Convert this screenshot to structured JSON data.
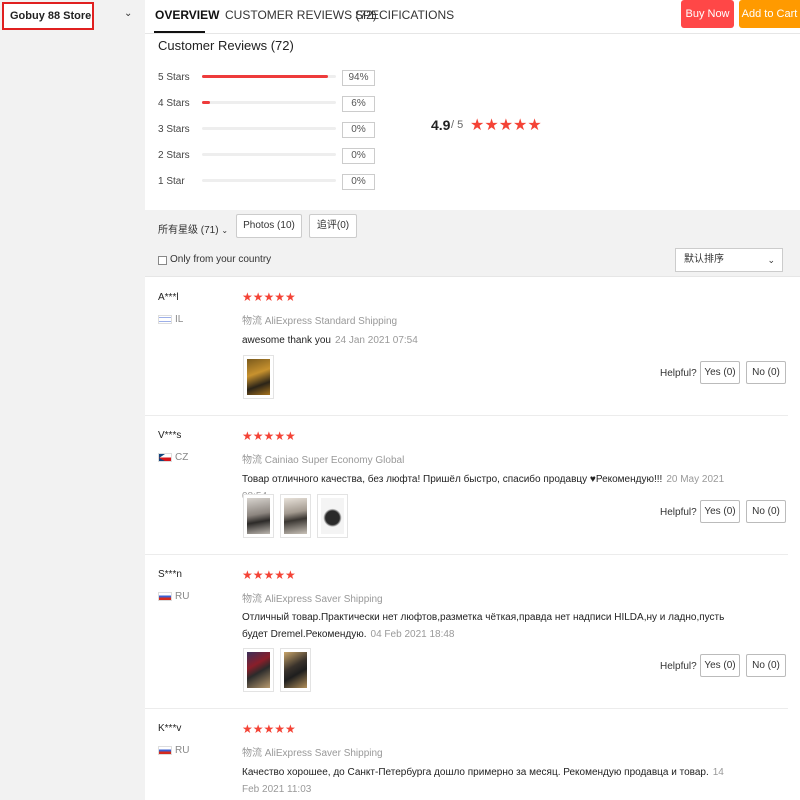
{
  "store": {
    "name": "Gobuy 88 Store",
    "chevron": "⌄"
  },
  "tabs": [
    {
      "label": "OVERVIEW"
    },
    {
      "label": "CUSTOMER REVIEWS (72)"
    },
    {
      "label": "SPECIFICATIONS"
    }
  ],
  "actions": {
    "buy_now": "Buy Now",
    "add_to_cart": "Add to Cart"
  },
  "summary": {
    "title": "Customer Reviews (72)",
    "score": "4.9",
    "out_of": "/ 5",
    "stars": "★★★★★",
    "distribution": [
      {
        "label": "5 Stars",
        "percent_text": "94%",
        "fraction": 0.94
      },
      {
        "label": "4 Stars",
        "percent_text": "6%",
        "fraction": 0.06
      },
      {
        "label": "3 Stars",
        "percent_text": "0%",
        "fraction": 0
      },
      {
        "label": "2 Stars",
        "percent_text": "0%",
        "fraction": 0
      },
      {
        "label": "1 Star",
        "percent_text": "0%",
        "fraction": 0
      }
    ]
  },
  "filters": {
    "all_ratings": "所有星级 (71)",
    "photos": "Photos (10)",
    "additional": "追评(0)",
    "only_country": "Only from your country",
    "sort": "默认排序"
  },
  "reviews": [
    {
      "name": "A***l",
      "country": "IL",
      "stars": "★★★★★",
      "shipping": "物流 AliExpress Standard Shipping",
      "comment": "awesome thank you",
      "date": "24 Jan 2021 07:54",
      "helpful": "Helpful?",
      "yes": "Yes (0)",
      "no": "No (0)"
    },
    {
      "name": "V***s",
      "country": "CZ",
      "stars": "★★★★★",
      "shipping": "物流 Cainiao Super Economy Global",
      "comment": "Товар отличного качества, без люфта! Пришёл быстро, спасибо продавцу ♥Рекомендую!!!",
      "date": "20 May 2021 08:54",
      "helpful": "Helpful?",
      "yes": "Yes (0)",
      "no": "No (0)"
    },
    {
      "name": "S***n",
      "country": "RU",
      "stars": "★★★★★",
      "shipping": "物流 AliExpress Saver Shipping",
      "comment": "Отличный товар.Практически нет люфтов,разметка чёткая,правда нет надписи HILDA,ну и ладно,пусть будет Dremel.Рекомендую.",
      "date": "04 Feb 2021 18:48",
      "helpful": "Helpful?",
      "yes": "Yes (0)",
      "no": "No (0)"
    },
    {
      "name": "K***v",
      "country": "RU",
      "stars": "★★★★★",
      "shipping": "物流 AliExpress Saver Shipping",
      "comment": "Качество хорошее, до Санкт-Петербурга дошло примерно за месяц. Рекомендую продавца и товар.",
      "date": "14 Feb 2021 11:03"
    }
  ]
}
